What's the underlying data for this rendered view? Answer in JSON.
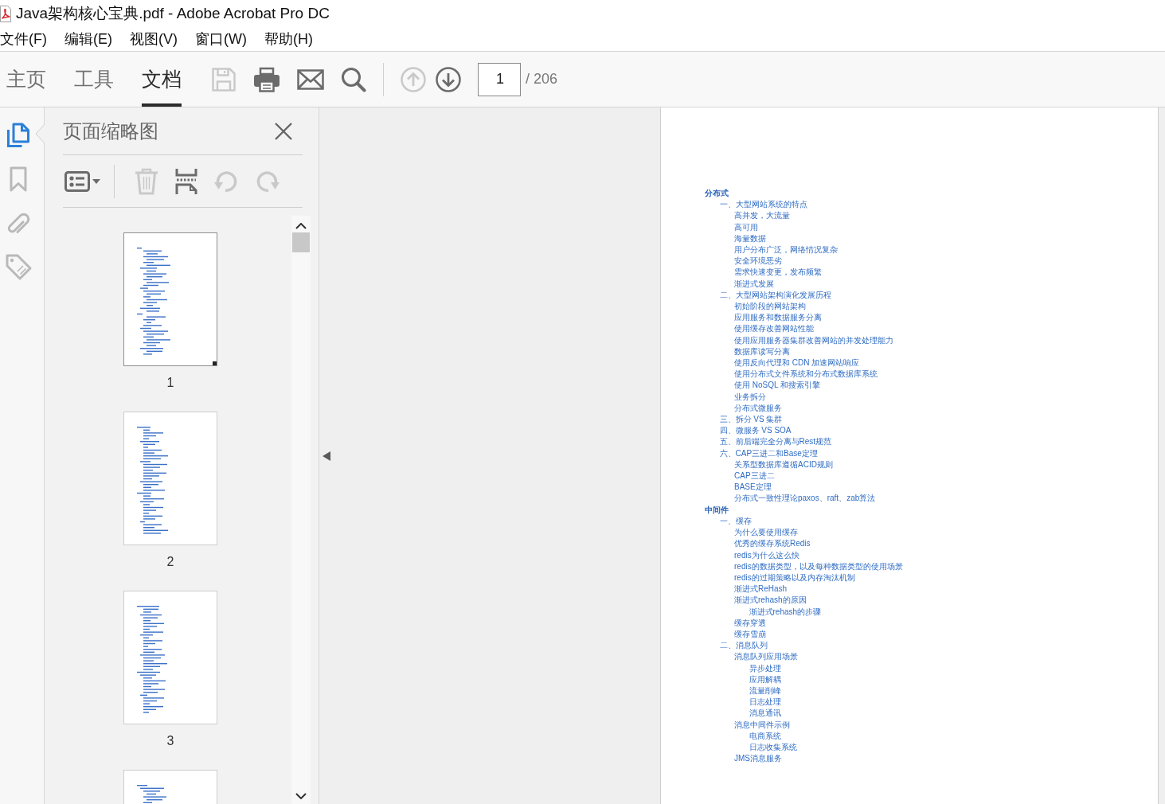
{
  "window": {
    "title": "Java架构核心宝典.pdf - Adobe Acrobat Pro DC"
  },
  "menu": [
    "文件(F)",
    "编辑(E)",
    "视图(V)",
    "窗口(W)",
    "帮助(H)"
  ],
  "toolbar": {
    "tabs": [
      {
        "label": "主页",
        "selected": false
      },
      {
        "label": "工具",
        "selected": false
      },
      {
        "label": "文档",
        "selected": true
      }
    ],
    "buttons": [
      {
        "disabled": true
      },
      {
        "disabled": false
      },
      {
        "disabled": false
      },
      {
        "disabled": false
      }
    ],
    "page_buttons": [
      {
        "disabled": true
      },
      {
        "disabled": false
      }
    ],
    "current_page": "1",
    "page_total": "/ 206"
  },
  "sidebar": {
    "rail": [
      {
        "selected": true
      },
      {
        "selected": false
      },
      {
        "selected": false
      },
      {
        "selected": false
      }
    ],
    "panel": {
      "title": "页面缩略图",
      "tools": [
        {
          "disabled": false
        },
        {
          "disabled": true
        },
        {
          "disabled": false
        },
        {
          "disabled": true
        },
        {
          "disabled": true
        }
      ],
      "thumbnails": [
        {
          "label": "1",
          "selected": true
        },
        {
          "label": "2",
          "selected": false
        },
        {
          "label": "3",
          "selected": false
        },
        {
          "selected": false
        }
      ]
    }
  },
  "document": {
    "toc": [
      {
        "title": "分布式",
        "children": [
          {
            "number": "一、",
            "title": "大型网站系统的特点",
            "children": [
              {
                "title": "高并发，大流量"
              },
              {
                "title": "高可用"
              },
              {
                "title": "海量数据"
              },
              {
                "title": "用户分布广泛，网络情况复杂"
              },
              {
                "title": "安全环境恶劣"
              },
              {
                "title": "需求快速变更，发布频繁"
              },
              {
                "title": "渐进式发展"
              }
            ]
          },
          {
            "number": "二、",
            "title": "大型网站架构演化发展历程",
            "children": [
              {
                "title": "初始阶段的网站架构"
              },
              {
                "title": "应用服务和数据服务分离"
              },
              {
                "title": "使用缓存改善网站性能"
              },
              {
                "title": "使用应用服务器集群改善网站的并发处理能力"
              },
              {
                "title": "数据库读写分离"
              },
              {
                "title": "使用反向代理和 CDN 加速网站响应"
              },
              {
                "title": "使用分布式文件系统和分布式数据库系统"
              },
              {
                "title": "使用 NoSQL 和搜索引擎"
              },
              {
                "title": "业务拆分"
              },
              {
                "title": "分布式微服务"
              }
            ]
          },
          {
            "number": "三、",
            "title": "拆分 VS 集群"
          },
          {
            "number": "四、",
            "title": "微服务 VS SOA"
          },
          {
            "number": "五、",
            "title": "前后端完全分离与Rest规范"
          },
          {
            "number": "六、",
            "title": "CAP三进二和Base定理",
            "children": [
              {
                "title": "关系型数据库遵循ACID规则"
              },
              {
                "title": "CAP三进二"
              },
              {
                "title": "BASE定理"
              },
              {
                "title": "分布式一致性理论paxos、raft、zab算法"
              }
            ]
          }
        ]
      },
      {
        "title": "中间件",
        "children": [
          {
            "number": "一、",
            "title": "缓存",
            "children": [
              {
                "title": "为什么要使用缓存"
              },
              {
                "title": "优秀的缓存系统Redis"
              },
              {
                "title": "redis为什么这么快"
              },
              {
                "title": "redis的数据类型，以及每种数据类型的使用场景"
              },
              {
                "title": "redis的过期策略以及内存淘汰机制"
              },
              {
                "title": "渐进式ReHash"
              },
              {
                "title": "渐进式rehash的原因",
                "children": [
                  {
                    "title": "渐进式rehash的步骤"
                  }
                ]
              },
              {
                "title": "缓存穿透"
              },
              {
                "title": "缓存雪崩"
              }
            ]
          },
          {
            "number": "二、",
            "title": "消息队列",
            "children": [
              {
                "title": "消息队列应用场景",
                "children": [
                  {
                    "title": "异步处理"
                  },
                  {
                    "title": "应用解耦"
                  },
                  {
                    "title": "流量削峰"
                  },
                  {
                    "title": "日志处理"
                  },
                  {
                    "title": "消息通讯"
                  }
                ]
              },
              {
                "title": "消息中间件示例",
                "children": [
                  {
                    "title": "电商系统"
                  },
                  {
                    "title": "日志收集系统"
                  }
                ]
              },
              {
                "title": "JMS消息服务"
              }
            ]
          }
        ]
      }
    ]
  }
}
